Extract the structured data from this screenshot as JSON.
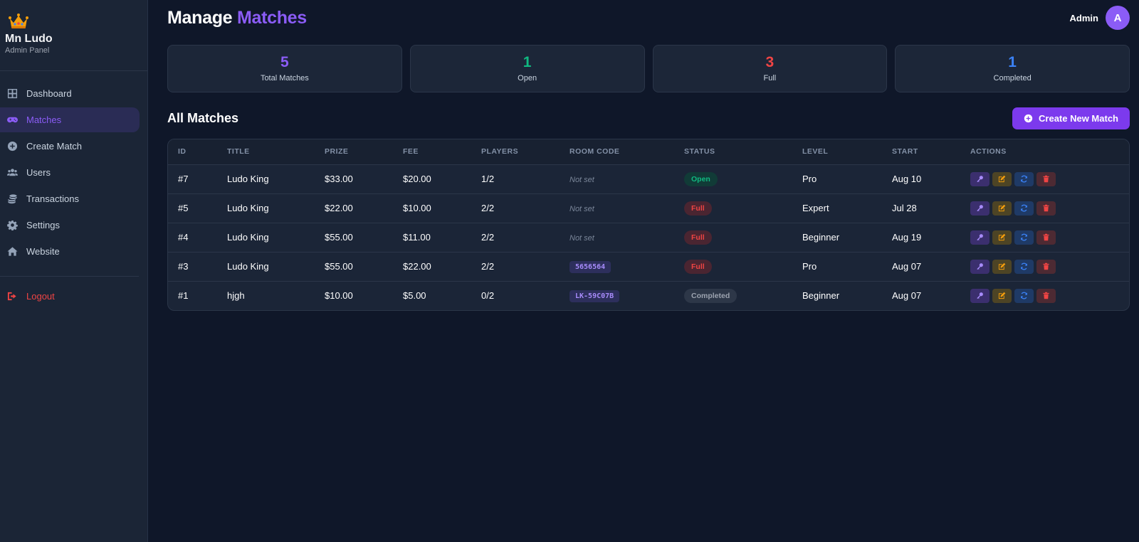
{
  "brand": {
    "name": "Mn Ludo",
    "subtitle": "Admin Panel",
    "logo_icon": "crown-icon"
  },
  "sidebar": {
    "items": [
      {
        "label": "Dashboard",
        "icon": "grid-icon",
        "active": false
      },
      {
        "label": "Matches",
        "icon": "gamepad-icon",
        "active": true
      },
      {
        "label": "Create Match",
        "icon": "plus-circle-icon",
        "active": false
      },
      {
        "label": "Users",
        "icon": "users-icon",
        "active": false
      },
      {
        "label": "Transactions",
        "icon": "coins-icon",
        "active": false
      },
      {
        "label": "Settings",
        "icon": "gear-icon",
        "active": false
      },
      {
        "label": "Website",
        "icon": "home-icon",
        "active": false
      }
    ],
    "logout_label": "Logout"
  },
  "header": {
    "title_main": "Manage ",
    "title_accent": "Matches",
    "user_name": "Admin",
    "avatar_letter": "A"
  },
  "stats": [
    {
      "value": "5",
      "label": "Total Matches",
      "color": "#8b5cf6"
    },
    {
      "value": "1",
      "label": "Open",
      "color": "#10b981"
    },
    {
      "value": "3",
      "label": "Full",
      "color": "#ef4444"
    },
    {
      "value": "1",
      "label": "Completed",
      "color": "#3b82f6"
    }
  ],
  "section": {
    "title": "All Matches",
    "create_button": "Create New Match"
  },
  "table": {
    "columns": [
      "ID",
      "TITLE",
      "PRIZE",
      "FEE",
      "PLAYERS",
      "ROOM CODE",
      "STATUS",
      "LEVEL",
      "START",
      "ACTIONS"
    ],
    "rows": [
      {
        "id": "#7",
        "title": "Ludo King",
        "prize": "$33.00",
        "fee": "$20.00",
        "players": "1/2",
        "room_code": "Not set",
        "status": "Open",
        "level": "Pro",
        "start": "Aug 10"
      },
      {
        "id": "#5",
        "title": "Ludo King",
        "prize": "$22.00",
        "fee": "$10.00",
        "players": "2/2",
        "room_code": "Not set",
        "status": "Full",
        "level": "Expert",
        "start": "Jul 28"
      },
      {
        "id": "#4",
        "title": "Ludo King",
        "prize": "$55.00",
        "fee": "$11.00",
        "players": "2/2",
        "room_code": "Not set",
        "status": "Full",
        "level": "Beginner",
        "start": "Aug 19"
      },
      {
        "id": "#3",
        "title": "Ludo King",
        "prize": "$55.00",
        "fee": "$22.00",
        "players": "2/2",
        "room_code": "5656564",
        "status": "Full",
        "level": "Pro",
        "start": "Aug 07"
      },
      {
        "id": "#1",
        "title": "hjgh",
        "prize": "$10.00",
        "fee": "$5.00",
        "players": "0/2",
        "room_code": "LK-59C07B",
        "status": "Completed",
        "level": "Beginner",
        "start": "Aug 07"
      }
    ],
    "status_colors": {
      "Open": {
        "fg": "#10b981",
        "bg": "#113b37"
      },
      "Full": {
        "fg": "#ef4444",
        "bg": "#4a2531"
      },
      "Completed": {
        "fg": "#9ca3af",
        "bg": "#2d3748"
      }
    },
    "action_icons": [
      "key-icon",
      "edit-icon",
      "sync-icon",
      "trash-icon"
    ]
  }
}
